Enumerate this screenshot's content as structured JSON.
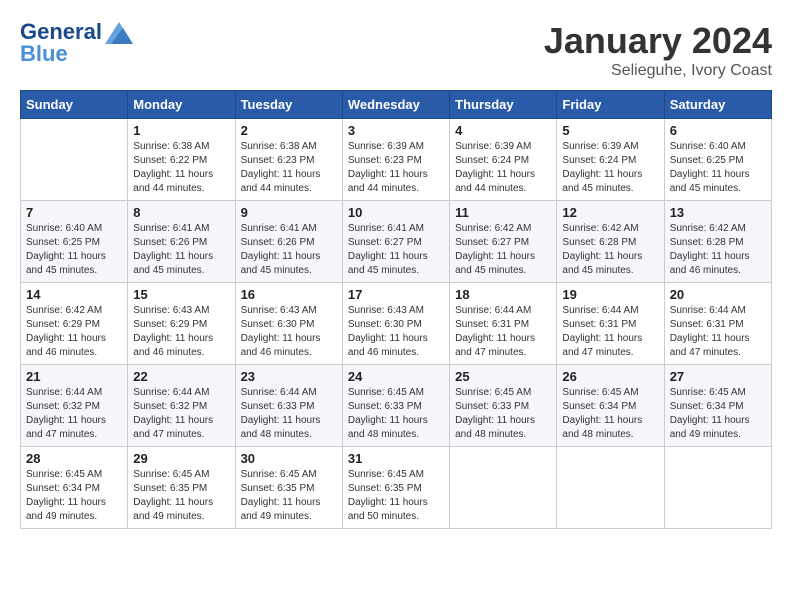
{
  "header": {
    "logo_line1": "General",
    "logo_line2": "Blue",
    "month": "January 2024",
    "location": "Selieguhe, Ivory Coast"
  },
  "days_of_week": [
    "Sunday",
    "Monday",
    "Tuesday",
    "Wednesday",
    "Thursday",
    "Friday",
    "Saturday"
  ],
  "weeks": [
    [
      {
        "day": "",
        "info": ""
      },
      {
        "day": "1",
        "info": "Sunrise: 6:38 AM\nSunset: 6:22 PM\nDaylight: 11 hours\nand 44 minutes."
      },
      {
        "day": "2",
        "info": "Sunrise: 6:38 AM\nSunset: 6:23 PM\nDaylight: 11 hours\nand 44 minutes."
      },
      {
        "day": "3",
        "info": "Sunrise: 6:39 AM\nSunset: 6:23 PM\nDaylight: 11 hours\nand 44 minutes."
      },
      {
        "day": "4",
        "info": "Sunrise: 6:39 AM\nSunset: 6:24 PM\nDaylight: 11 hours\nand 44 minutes."
      },
      {
        "day": "5",
        "info": "Sunrise: 6:39 AM\nSunset: 6:24 PM\nDaylight: 11 hours\nand 45 minutes."
      },
      {
        "day": "6",
        "info": "Sunrise: 6:40 AM\nSunset: 6:25 PM\nDaylight: 11 hours\nand 45 minutes."
      }
    ],
    [
      {
        "day": "7",
        "info": "Sunrise: 6:40 AM\nSunset: 6:25 PM\nDaylight: 11 hours\nand 45 minutes."
      },
      {
        "day": "8",
        "info": "Sunrise: 6:41 AM\nSunset: 6:26 PM\nDaylight: 11 hours\nand 45 minutes."
      },
      {
        "day": "9",
        "info": "Sunrise: 6:41 AM\nSunset: 6:26 PM\nDaylight: 11 hours\nand 45 minutes."
      },
      {
        "day": "10",
        "info": "Sunrise: 6:41 AM\nSunset: 6:27 PM\nDaylight: 11 hours\nand 45 minutes."
      },
      {
        "day": "11",
        "info": "Sunrise: 6:42 AM\nSunset: 6:27 PM\nDaylight: 11 hours\nand 45 minutes."
      },
      {
        "day": "12",
        "info": "Sunrise: 6:42 AM\nSunset: 6:28 PM\nDaylight: 11 hours\nand 45 minutes."
      },
      {
        "day": "13",
        "info": "Sunrise: 6:42 AM\nSunset: 6:28 PM\nDaylight: 11 hours\nand 46 minutes."
      }
    ],
    [
      {
        "day": "14",
        "info": "Sunrise: 6:42 AM\nSunset: 6:29 PM\nDaylight: 11 hours\nand 46 minutes."
      },
      {
        "day": "15",
        "info": "Sunrise: 6:43 AM\nSunset: 6:29 PM\nDaylight: 11 hours\nand 46 minutes."
      },
      {
        "day": "16",
        "info": "Sunrise: 6:43 AM\nSunset: 6:30 PM\nDaylight: 11 hours\nand 46 minutes."
      },
      {
        "day": "17",
        "info": "Sunrise: 6:43 AM\nSunset: 6:30 PM\nDaylight: 11 hours\nand 46 minutes."
      },
      {
        "day": "18",
        "info": "Sunrise: 6:44 AM\nSunset: 6:31 PM\nDaylight: 11 hours\nand 47 minutes."
      },
      {
        "day": "19",
        "info": "Sunrise: 6:44 AM\nSunset: 6:31 PM\nDaylight: 11 hours\nand 47 minutes."
      },
      {
        "day": "20",
        "info": "Sunrise: 6:44 AM\nSunset: 6:31 PM\nDaylight: 11 hours\nand 47 minutes."
      }
    ],
    [
      {
        "day": "21",
        "info": "Sunrise: 6:44 AM\nSunset: 6:32 PM\nDaylight: 11 hours\nand 47 minutes."
      },
      {
        "day": "22",
        "info": "Sunrise: 6:44 AM\nSunset: 6:32 PM\nDaylight: 11 hours\nand 47 minutes."
      },
      {
        "day": "23",
        "info": "Sunrise: 6:44 AM\nSunset: 6:33 PM\nDaylight: 11 hours\nand 48 minutes."
      },
      {
        "day": "24",
        "info": "Sunrise: 6:45 AM\nSunset: 6:33 PM\nDaylight: 11 hours\nand 48 minutes."
      },
      {
        "day": "25",
        "info": "Sunrise: 6:45 AM\nSunset: 6:33 PM\nDaylight: 11 hours\nand 48 minutes."
      },
      {
        "day": "26",
        "info": "Sunrise: 6:45 AM\nSunset: 6:34 PM\nDaylight: 11 hours\nand 48 minutes."
      },
      {
        "day": "27",
        "info": "Sunrise: 6:45 AM\nSunset: 6:34 PM\nDaylight: 11 hours\nand 49 minutes."
      }
    ],
    [
      {
        "day": "28",
        "info": "Sunrise: 6:45 AM\nSunset: 6:34 PM\nDaylight: 11 hours\nand 49 minutes."
      },
      {
        "day": "29",
        "info": "Sunrise: 6:45 AM\nSunset: 6:35 PM\nDaylight: 11 hours\nand 49 minutes."
      },
      {
        "day": "30",
        "info": "Sunrise: 6:45 AM\nSunset: 6:35 PM\nDaylight: 11 hours\nand 49 minutes."
      },
      {
        "day": "31",
        "info": "Sunrise: 6:45 AM\nSunset: 6:35 PM\nDaylight: 11 hours\nand 50 minutes."
      },
      {
        "day": "",
        "info": ""
      },
      {
        "day": "",
        "info": ""
      },
      {
        "day": "",
        "info": ""
      }
    ]
  ]
}
